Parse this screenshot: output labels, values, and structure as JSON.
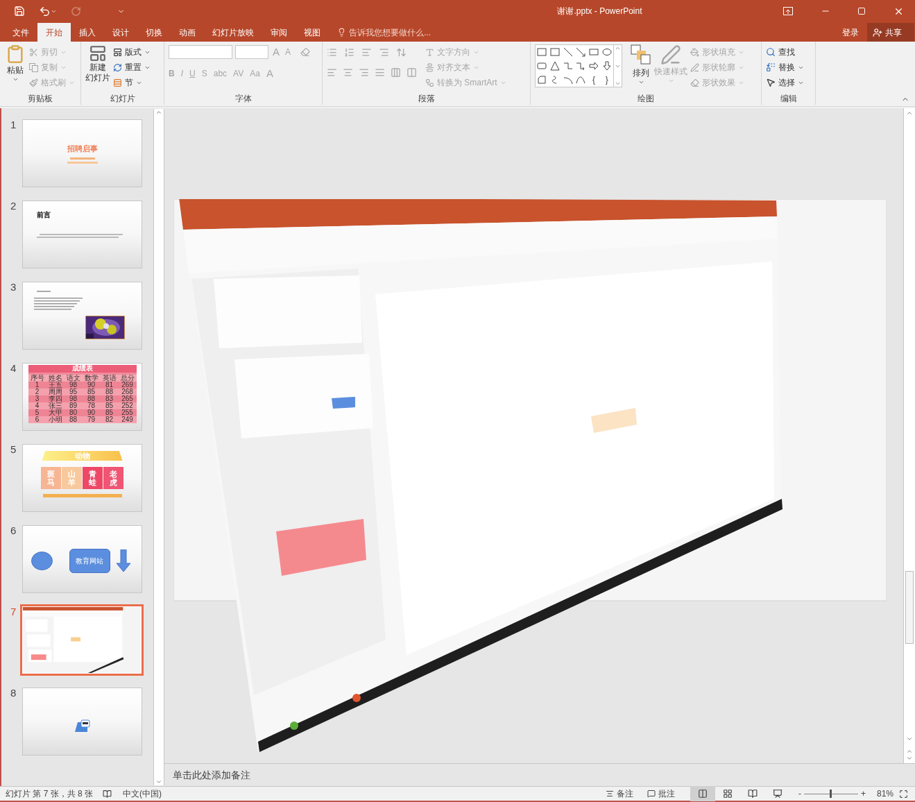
{
  "title_bar": {
    "title": "谢谢.pptx - PowerPoint"
  },
  "tabs": [
    {
      "label": "文件",
      "selected": false
    },
    {
      "label": "开始",
      "selected": true
    },
    {
      "label": "插入",
      "selected": false
    },
    {
      "label": "设计",
      "selected": false
    },
    {
      "label": "切换",
      "selected": false
    },
    {
      "label": "动画",
      "selected": false
    },
    {
      "label": "幻灯片放映",
      "selected": false
    },
    {
      "label": "审阅",
      "selected": false
    },
    {
      "label": "视图",
      "selected": false
    }
  ],
  "tell_me": "告诉我您想要做什么...",
  "sign_in": "登录",
  "share": "共享",
  "clipboard": {
    "label": "剪贴板",
    "paste": "粘贴",
    "items": [
      {
        "label": "剪切",
        "disabled": true
      },
      {
        "label": "复制",
        "disabled": true
      },
      {
        "label": "格式刷",
        "disabled": true
      }
    ]
  },
  "slides_group": {
    "label": "幻灯片",
    "new_slide": [
      "新建",
      "幻灯片"
    ],
    "items": [
      {
        "label": "版式",
        "disabled": false
      },
      {
        "label": "重置",
        "disabled": false
      },
      {
        "label": "节",
        "disabled": false
      }
    ]
  },
  "font": {
    "label": "字体",
    "size_buttons": [
      "A",
      "A"
    ],
    "format_buttons": [
      "B",
      "I",
      "U",
      "S",
      "abc",
      "AV",
      "Aa",
      "A"
    ]
  },
  "paragraph": {
    "label": "段落",
    "items": [
      {
        "label": "文字方向",
        "disabled": true
      },
      {
        "label": "对齐文本",
        "disabled": true
      },
      {
        "label": "转换为 SmartArt",
        "disabled": true
      }
    ]
  },
  "drawing": {
    "label": "绘图",
    "gallery_glyphs": [
      "{",
      "}"
    ],
    "arrange": "排列",
    "quick_styles": {
      "label": "快速样式",
      "disabled": true
    },
    "items": [
      {
        "label": "形状填充",
        "disabled": true
      },
      {
        "label": "形状轮廓",
        "disabled": true
      },
      {
        "label": "形状效果",
        "disabled": true
      }
    ]
  },
  "editing": {
    "label": "编辑",
    "items": [
      {
        "label": "查找",
        "disabled": false
      },
      {
        "label": "替换",
        "disabled": false
      },
      {
        "label": "选择",
        "disabled": false
      }
    ]
  },
  "thumbnails": [
    {
      "number": "1",
      "selected": false,
      "kind": "title",
      "title": "招聘启事"
    },
    {
      "number": "2",
      "selected": false,
      "kind": "heading",
      "title": "前言"
    },
    {
      "number": "3",
      "selected": false,
      "kind": "text_photo"
    },
    {
      "number": "4",
      "selected": false,
      "kind": "table",
      "title": "成绩表",
      "columns": [
        "序号",
        "姓名",
        "语文",
        "数学",
        "英语",
        "总分"
      ],
      "rows": [
        [
          "1",
          "王五",
          "98",
          "90",
          "81",
          "269"
        ],
        [
          "2",
          "周周",
          "95",
          "85",
          "88",
          "268"
        ],
        [
          "3",
          "李四",
          "98",
          "88",
          "83",
          "265"
        ],
        [
          "4",
          "张三",
          "89",
          "78",
          "85",
          "252"
        ],
        [
          "5",
          "大甲",
          "80",
          "90",
          "85",
          "255"
        ],
        [
          "6",
          "小明",
          "88",
          "79",
          "82",
          "249"
        ]
      ]
    },
    {
      "number": "5",
      "selected": false,
      "kind": "animals",
      "title": "动物",
      "cells": [
        {
          "label": "斑马",
          "color": "#f7b594"
        },
        {
          "label": "山羊",
          "color": "#f8c99c"
        },
        {
          "label": "青蛙",
          "color": "#ee4866"
        },
        {
          "label": "老虎",
          "color": "#f05573"
        }
      ]
    },
    {
      "number": "6",
      "selected": false,
      "kind": "shapes",
      "label": "教育网站"
    },
    {
      "number": "7",
      "selected": true,
      "kind": "picture"
    },
    {
      "number": "8",
      "selected": false,
      "kind": "icon"
    }
  ],
  "notes": {
    "placeholder": "单击此处添加备注"
  },
  "status_bar": {
    "slide_info": "幻灯片 第 7 张，共 8 张",
    "language": "中文(中国)",
    "notes": "备注",
    "comments": "批注",
    "views": [
      {
        "kind": "normal",
        "selected": true
      },
      {
        "kind": "sorter",
        "selected": false
      },
      {
        "kind": "reading",
        "selected": false
      },
      {
        "kind": "show",
        "selected": false
      }
    ],
    "zoom": {
      "minus": "-",
      "plus": "+",
      "level": 0.49,
      "reading": "81%"
    }
  }
}
